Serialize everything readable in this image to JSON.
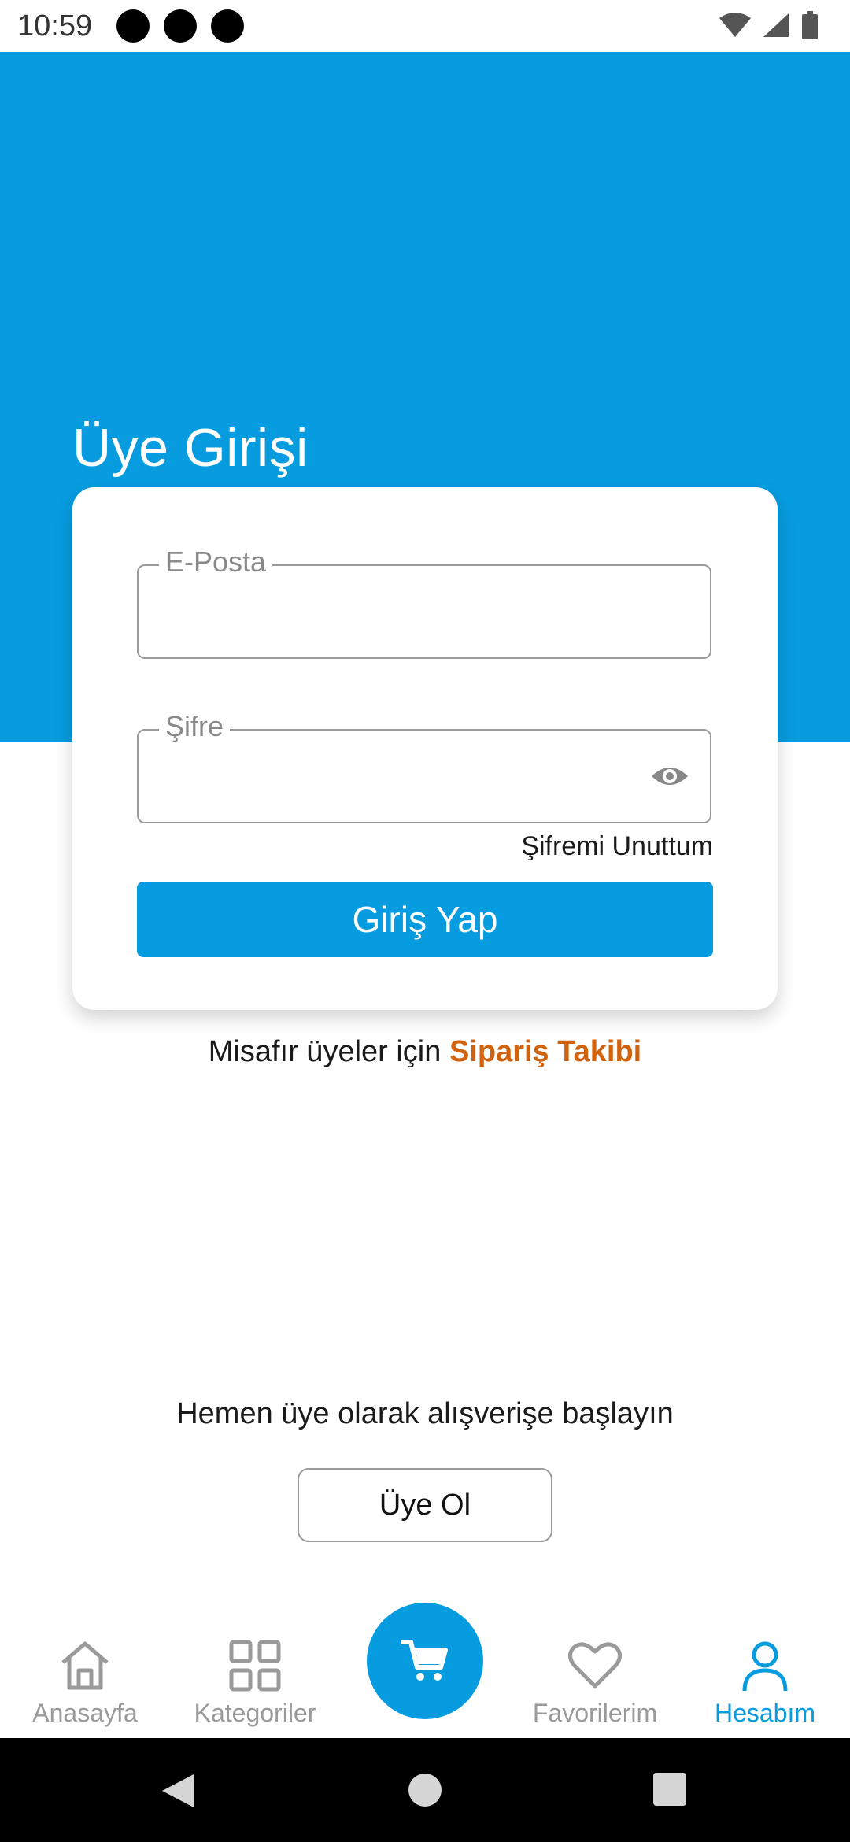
{
  "status_bar": {
    "time": "10:59"
  },
  "page": {
    "title": "Üye Girişi"
  },
  "login_form": {
    "email_label": "E-Posta",
    "email_value": "",
    "password_label": "Şifre",
    "password_value": "",
    "forgot_password": "Şifremi Unuttum",
    "submit_label": "Giriş Yap"
  },
  "guest": {
    "prefix": "Misafır üyeler için ",
    "link": "Sipariş Takibi"
  },
  "signup": {
    "prompt": "Hemen üye olarak alışverişe başlayın",
    "button_label": "Üye Ol"
  },
  "bottom_nav": {
    "items": [
      {
        "label": "Anasayfa",
        "icon": "home-icon"
      },
      {
        "label": "Kategoriler",
        "icon": "grid-icon"
      },
      {
        "label": "",
        "icon": "cart-icon"
      },
      {
        "label": "Favorilerim",
        "icon": "heart-icon"
      },
      {
        "label": "Hesabım",
        "icon": "user-icon",
        "active": true
      }
    ]
  },
  "colors": {
    "primary": "#079ce0",
    "accent_orange": "#d1620e",
    "inactive_gray": "#9a9a9a"
  }
}
